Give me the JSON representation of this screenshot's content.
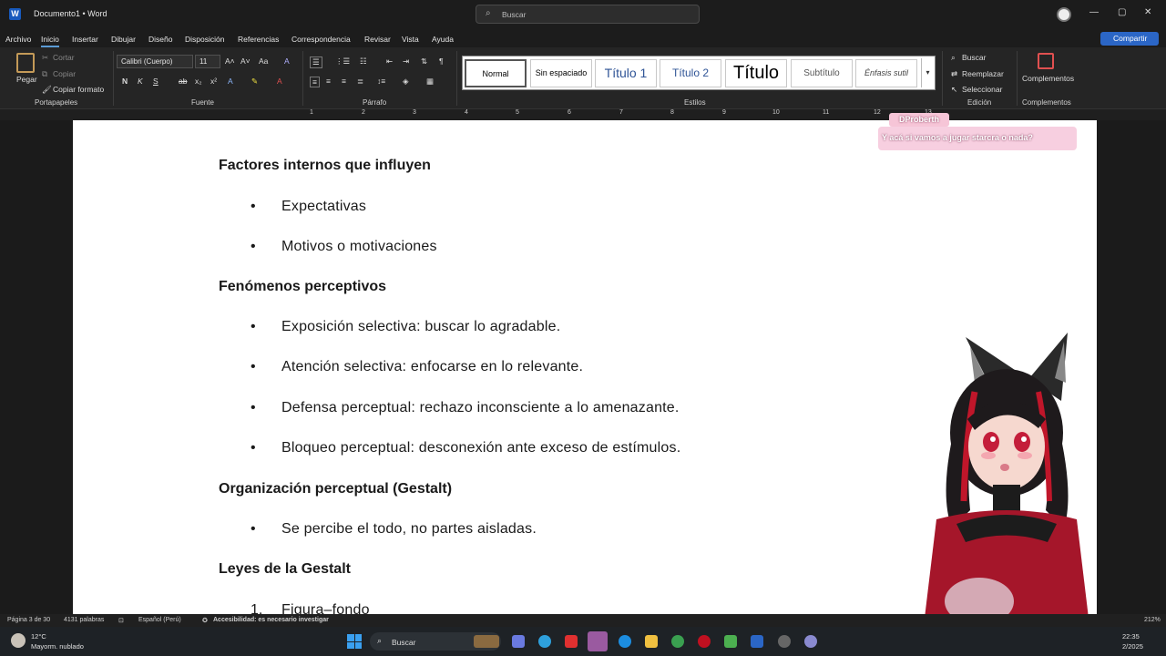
{
  "window": {
    "title": "Documento1 • Word",
    "search_placeholder": "Buscar",
    "share_label": "Compartir"
  },
  "menu": [
    "Archivo",
    "Inicio",
    "Insertar",
    "Dibujar",
    "Diseño",
    "Disposición",
    "Referencias",
    "Correspondencia",
    "Revisar",
    "Vista",
    "Ayuda"
  ],
  "ribbon": {
    "clipboard": {
      "paste": "Pegar",
      "cut": "Cortar",
      "copy": "Copiar",
      "format_painter": "Copiar formato",
      "group": "Portapapeles"
    },
    "font": {
      "name": "Calibri (Cuerpo)",
      "size": "11",
      "group": "Fuente"
    },
    "paragraph": {
      "group": "Párrafo"
    },
    "styles": {
      "group": "Estilos",
      "items": [
        "Normal",
        "Sin espaciado",
        "Título 1",
        "Título 2",
        "Título",
        "Subtítulo",
        "Énfasis sutil"
      ]
    },
    "editing": {
      "find": "Buscar",
      "replace": "Reemplazar",
      "select": "Seleccionar",
      "group": "Edición"
    },
    "addins": {
      "label": "Complementos",
      "group": "Complementos"
    }
  },
  "ruler": {
    "numbers": [
      "1",
      "2",
      "3",
      "4",
      "5",
      "6",
      "7",
      "8",
      "9",
      "10",
      "11",
      "12",
      "13"
    ]
  },
  "document": {
    "h1": "Factores internos que influyen",
    "h1_items": [
      "Expectativas",
      "Motivos o motivaciones"
    ],
    "h2": "Fenómenos perceptivos",
    "h2_items": [
      "Exposición selectiva: buscar lo agradable.",
      "Atención selectiva: enfocarse en lo relevante.",
      "Defensa perceptual: rechazo inconsciente a lo amenazante.",
      "Bloqueo perceptual: desconexión ante exceso de estímulos."
    ],
    "h3": "Organización perceptual (Gestalt)",
    "h3_items": [
      "Se percibe el todo, no partes aisladas."
    ],
    "h4": "Leyes de la Gestalt",
    "h4_items": [
      "Figura–fondo"
    ],
    "h4_number": "1."
  },
  "overlay": {
    "name": "DProberth",
    "message": "Y acá si vamos a jugar starcra o nada?"
  },
  "statusbar": {
    "page": "Página 3 de 30",
    "words": "4131 palabras",
    "language": "Español (Perú)",
    "accessibility": "Accesibilidad: es necesario investigar",
    "zoom": "212%"
  },
  "taskbar": {
    "weather_temp": "12°C",
    "weather_desc": "Mayorm. nublado",
    "search": "Buscar",
    "time": "22:35",
    "date": "2/2025"
  }
}
